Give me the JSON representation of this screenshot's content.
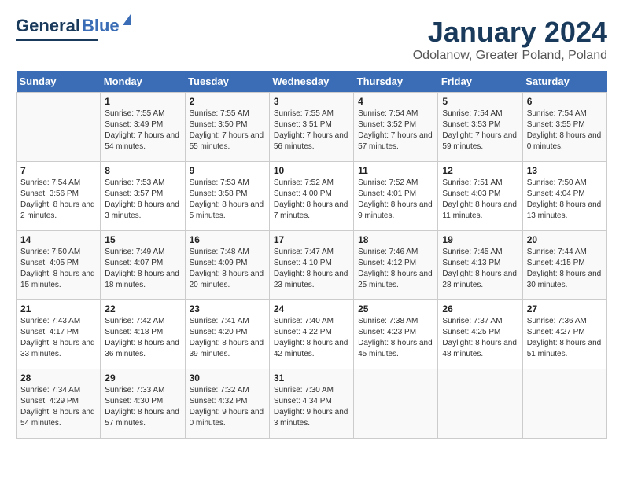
{
  "header": {
    "logo_general": "General",
    "logo_blue": "Blue",
    "month_title": "January 2024",
    "location": "Odolanow, Greater Poland, Poland"
  },
  "weekdays": [
    "Sunday",
    "Monday",
    "Tuesday",
    "Wednesday",
    "Thursday",
    "Friday",
    "Saturday"
  ],
  "weeks": [
    [
      {
        "day": "",
        "sunrise": "",
        "sunset": "",
        "daylight": ""
      },
      {
        "day": "1",
        "sunrise": "Sunrise: 7:55 AM",
        "sunset": "Sunset: 3:49 PM",
        "daylight": "Daylight: 7 hours and 54 minutes."
      },
      {
        "day": "2",
        "sunrise": "Sunrise: 7:55 AM",
        "sunset": "Sunset: 3:50 PM",
        "daylight": "Daylight: 7 hours and 55 minutes."
      },
      {
        "day": "3",
        "sunrise": "Sunrise: 7:55 AM",
        "sunset": "Sunset: 3:51 PM",
        "daylight": "Daylight: 7 hours and 56 minutes."
      },
      {
        "day": "4",
        "sunrise": "Sunrise: 7:54 AM",
        "sunset": "Sunset: 3:52 PM",
        "daylight": "Daylight: 7 hours and 57 minutes."
      },
      {
        "day": "5",
        "sunrise": "Sunrise: 7:54 AM",
        "sunset": "Sunset: 3:53 PM",
        "daylight": "Daylight: 7 hours and 59 minutes."
      },
      {
        "day": "6",
        "sunrise": "Sunrise: 7:54 AM",
        "sunset": "Sunset: 3:55 PM",
        "daylight": "Daylight: 8 hours and 0 minutes."
      }
    ],
    [
      {
        "day": "7",
        "sunrise": "Sunrise: 7:54 AM",
        "sunset": "Sunset: 3:56 PM",
        "daylight": "Daylight: 8 hours and 2 minutes."
      },
      {
        "day": "8",
        "sunrise": "Sunrise: 7:53 AM",
        "sunset": "Sunset: 3:57 PM",
        "daylight": "Daylight: 8 hours and 3 minutes."
      },
      {
        "day": "9",
        "sunrise": "Sunrise: 7:53 AM",
        "sunset": "Sunset: 3:58 PM",
        "daylight": "Daylight: 8 hours and 5 minutes."
      },
      {
        "day": "10",
        "sunrise": "Sunrise: 7:52 AM",
        "sunset": "Sunset: 4:00 PM",
        "daylight": "Daylight: 8 hours and 7 minutes."
      },
      {
        "day": "11",
        "sunrise": "Sunrise: 7:52 AM",
        "sunset": "Sunset: 4:01 PM",
        "daylight": "Daylight: 8 hours and 9 minutes."
      },
      {
        "day": "12",
        "sunrise": "Sunrise: 7:51 AM",
        "sunset": "Sunset: 4:03 PM",
        "daylight": "Daylight: 8 hours and 11 minutes."
      },
      {
        "day": "13",
        "sunrise": "Sunrise: 7:50 AM",
        "sunset": "Sunset: 4:04 PM",
        "daylight": "Daylight: 8 hours and 13 minutes."
      }
    ],
    [
      {
        "day": "14",
        "sunrise": "Sunrise: 7:50 AM",
        "sunset": "Sunset: 4:05 PM",
        "daylight": "Daylight: 8 hours and 15 minutes."
      },
      {
        "day": "15",
        "sunrise": "Sunrise: 7:49 AM",
        "sunset": "Sunset: 4:07 PM",
        "daylight": "Daylight: 8 hours and 18 minutes."
      },
      {
        "day": "16",
        "sunrise": "Sunrise: 7:48 AM",
        "sunset": "Sunset: 4:09 PM",
        "daylight": "Daylight: 8 hours and 20 minutes."
      },
      {
        "day": "17",
        "sunrise": "Sunrise: 7:47 AM",
        "sunset": "Sunset: 4:10 PM",
        "daylight": "Daylight: 8 hours and 23 minutes."
      },
      {
        "day": "18",
        "sunrise": "Sunrise: 7:46 AM",
        "sunset": "Sunset: 4:12 PM",
        "daylight": "Daylight: 8 hours and 25 minutes."
      },
      {
        "day": "19",
        "sunrise": "Sunrise: 7:45 AM",
        "sunset": "Sunset: 4:13 PM",
        "daylight": "Daylight: 8 hours and 28 minutes."
      },
      {
        "day": "20",
        "sunrise": "Sunrise: 7:44 AM",
        "sunset": "Sunset: 4:15 PM",
        "daylight": "Daylight: 8 hours and 30 minutes."
      }
    ],
    [
      {
        "day": "21",
        "sunrise": "Sunrise: 7:43 AM",
        "sunset": "Sunset: 4:17 PM",
        "daylight": "Daylight: 8 hours and 33 minutes."
      },
      {
        "day": "22",
        "sunrise": "Sunrise: 7:42 AM",
        "sunset": "Sunset: 4:18 PM",
        "daylight": "Daylight: 8 hours and 36 minutes."
      },
      {
        "day": "23",
        "sunrise": "Sunrise: 7:41 AM",
        "sunset": "Sunset: 4:20 PM",
        "daylight": "Daylight: 8 hours and 39 minutes."
      },
      {
        "day": "24",
        "sunrise": "Sunrise: 7:40 AM",
        "sunset": "Sunset: 4:22 PM",
        "daylight": "Daylight: 8 hours and 42 minutes."
      },
      {
        "day": "25",
        "sunrise": "Sunrise: 7:38 AM",
        "sunset": "Sunset: 4:23 PM",
        "daylight": "Daylight: 8 hours and 45 minutes."
      },
      {
        "day": "26",
        "sunrise": "Sunrise: 7:37 AM",
        "sunset": "Sunset: 4:25 PM",
        "daylight": "Daylight: 8 hours and 48 minutes."
      },
      {
        "day": "27",
        "sunrise": "Sunrise: 7:36 AM",
        "sunset": "Sunset: 4:27 PM",
        "daylight": "Daylight: 8 hours and 51 minutes."
      }
    ],
    [
      {
        "day": "28",
        "sunrise": "Sunrise: 7:34 AM",
        "sunset": "Sunset: 4:29 PM",
        "daylight": "Daylight: 8 hours and 54 minutes."
      },
      {
        "day": "29",
        "sunrise": "Sunrise: 7:33 AM",
        "sunset": "Sunset: 4:30 PM",
        "daylight": "Daylight: 8 hours and 57 minutes."
      },
      {
        "day": "30",
        "sunrise": "Sunrise: 7:32 AM",
        "sunset": "Sunset: 4:32 PM",
        "daylight": "Daylight: 9 hours and 0 minutes."
      },
      {
        "day": "31",
        "sunrise": "Sunrise: 7:30 AM",
        "sunset": "Sunset: 4:34 PM",
        "daylight": "Daylight: 9 hours and 3 minutes."
      },
      {
        "day": "",
        "sunrise": "",
        "sunset": "",
        "daylight": ""
      },
      {
        "day": "",
        "sunrise": "",
        "sunset": "",
        "daylight": ""
      },
      {
        "day": "",
        "sunrise": "",
        "sunset": "",
        "daylight": ""
      }
    ]
  ]
}
